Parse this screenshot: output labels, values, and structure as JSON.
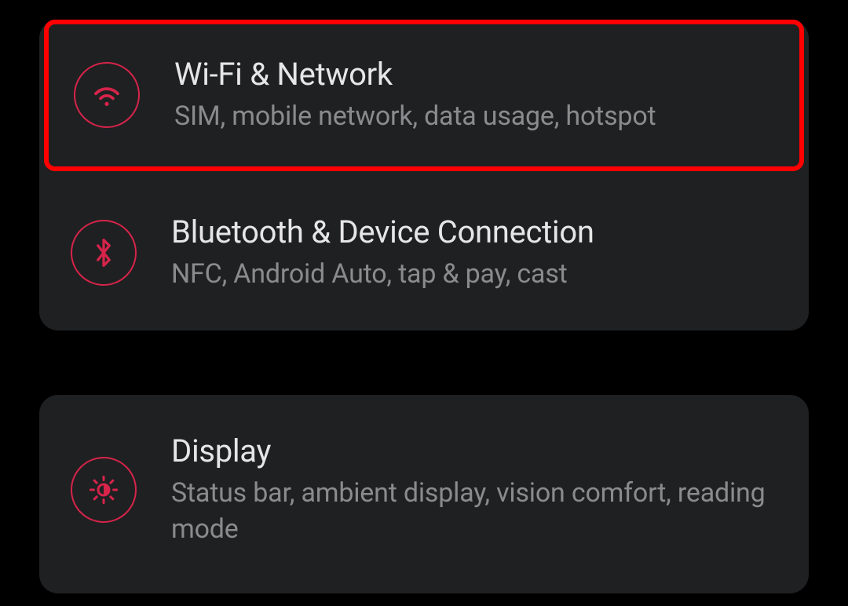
{
  "colors": {
    "accent": "#d6244a",
    "highlight_border": "#ff0000",
    "card_bg": "#1f2022",
    "title": "#e6e6e7",
    "subtitle": "#8a8b8d",
    "page_bg": "#000000"
  },
  "group1": {
    "items": [
      {
        "title": "Wi-Fi & Network",
        "subtitle": "SIM, mobile network, data usage, hotspot",
        "icon": "wifi-icon",
        "highlighted": true
      },
      {
        "title": "Bluetooth & Device Connection",
        "subtitle": "NFC, Android Auto, tap & pay, cast",
        "icon": "bluetooth-icon",
        "highlighted": false
      }
    ]
  },
  "group2": {
    "items": [
      {
        "title": "Display",
        "subtitle": "Status bar, ambient display, vision comfort, reading mode",
        "icon": "brightness-icon",
        "highlighted": false
      }
    ]
  }
}
